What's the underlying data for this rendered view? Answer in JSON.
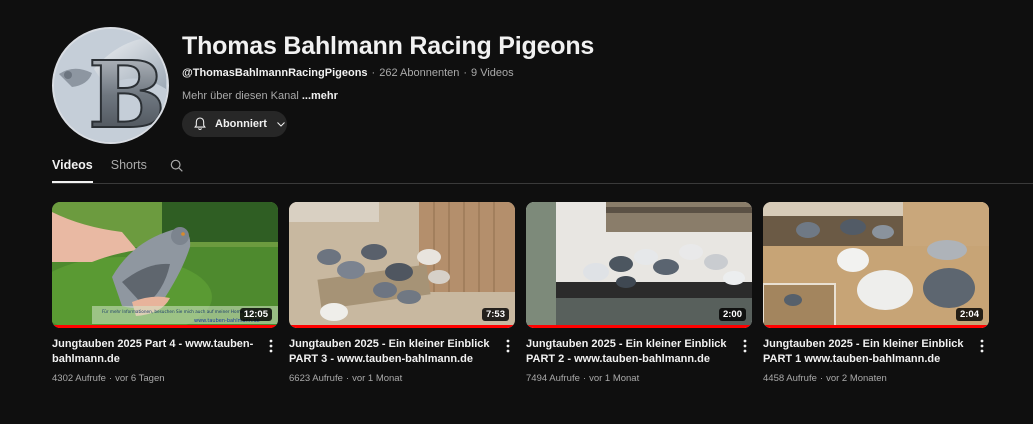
{
  "channel": {
    "title": "Thomas Bahlmann Racing Pigeons",
    "handle": "@ThomasBahlmannRacingPigeons",
    "subscribers": "262 Abonnenten",
    "videos_count": "9 Videos",
    "description": "Mehr über diesen Kanal ",
    "more_label": "...mehr",
    "subscribe_label": "Abonniert",
    "avatar_letter": "B"
  },
  "tabs": [
    {
      "label": "Videos",
      "active": true
    },
    {
      "label": "Shorts",
      "active": false
    }
  ],
  "icons": {
    "bell": "bell-icon",
    "chevron": "chevron-down-icon",
    "search": "search-icon",
    "kebab": "more-vert-icon"
  },
  "colors": {
    "background": "#0f0f0f",
    "progress": "#ff0000",
    "button_bg": "#272727"
  },
  "videos": [
    {
      "title": "Jungtauben 2025 Part 4 - www.tauben-bahlmann.de",
      "duration": "12:05",
      "views": "4302 Aufrufe",
      "age": "vor 6 Tagen",
      "watched_fraction": 1.0,
      "thumb_caption": "Für mehr Informationen, besuchen Sie mich auch auf meiner Homepage",
      "thumb_url_text": "www.tauben-bahlmann.de"
    },
    {
      "title": "Jungtauben 2025 - Ein kleiner Einblick PART 3 - www.tauben-bahlmann.de",
      "duration": "7:53",
      "views": "6623 Aufrufe",
      "age": "vor 1 Monat",
      "watched_fraction": 1.0
    },
    {
      "title": "Jungtauben 2025 - Ein kleiner Einblick PART 2 - www.tauben-bahlmann.de",
      "duration": "2:00",
      "views": "7494 Aufrufe",
      "age": "vor 1 Monat",
      "watched_fraction": 1.0
    },
    {
      "title": "Jungtauben 2025 - Ein kleiner Einblick PART 1 www.tauben-bahlmann.de",
      "duration": "2:04",
      "views": "4458 Aufrufe",
      "age": "vor 2 Monaten",
      "watched_fraction": 1.0
    }
  ]
}
